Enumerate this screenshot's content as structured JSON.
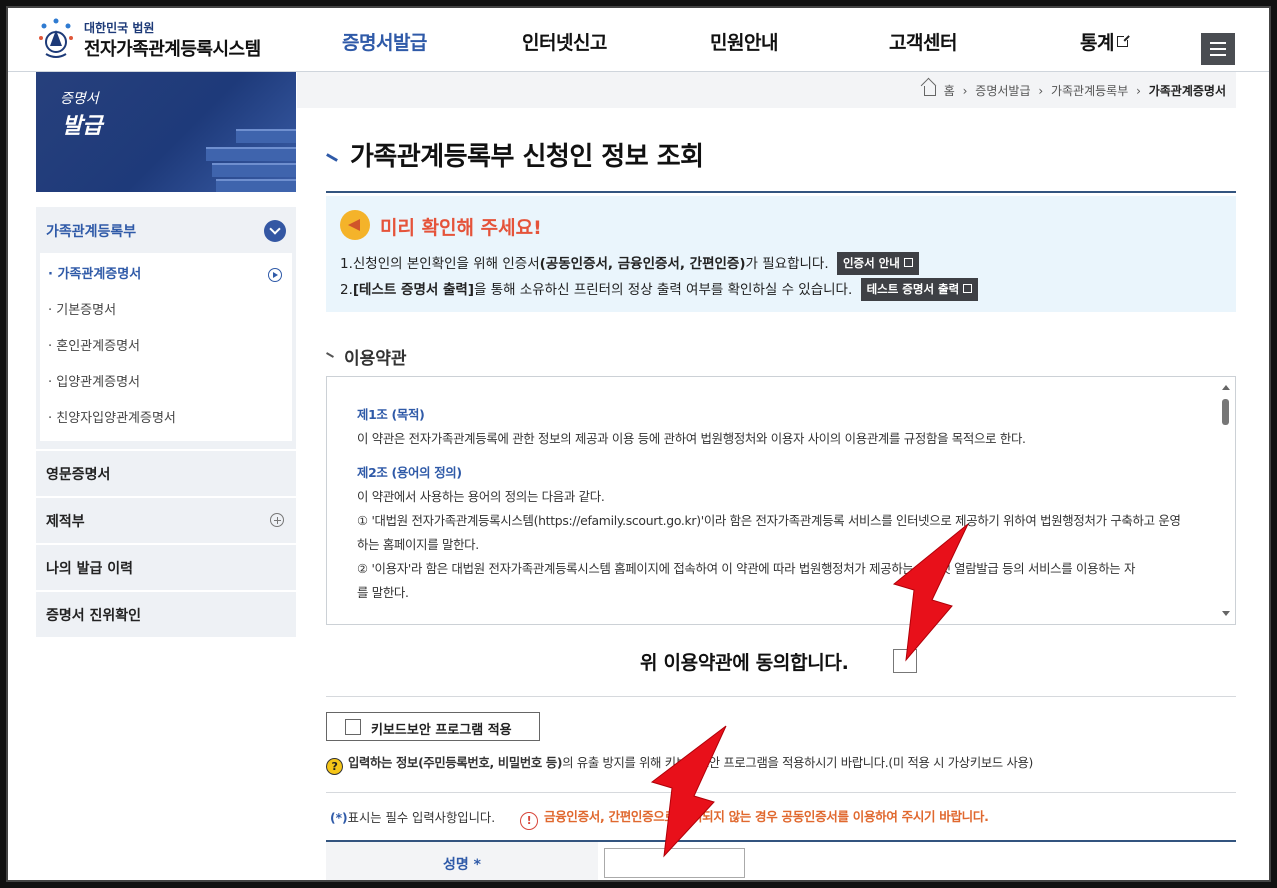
{
  "header": {
    "logo_sub": "대한민국 법원",
    "logo_main": "전자가족관계등록시스템",
    "nav": [
      {
        "label": "증명서발급"
      },
      {
        "label": "인터넷신고"
      },
      {
        "label": "민원안내"
      },
      {
        "label": "고객센터"
      },
      {
        "label": "통계"
      }
    ],
    "active_color": "#2f5aa8"
  },
  "banner": {
    "line1": "증명서",
    "line2": "발급"
  },
  "sidebar": {
    "group_title": "가족관계등록부",
    "sub_items": [
      {
        "label": "가족관계증명서"
      },
      {
        "label": "기본증명서"
      },
      {
        "label": "혼인관계증명서"
      },
      {
        "label": "입양관계증명서"
      },
      {
        "label": "친양자입양관계증명서"
      }
    ],
    "items": [
      {
        "label": "영문증명서"
      },
      {
        "label": "제적부"
      },
      {
        "label": "나의 발급 이력"
      },
      {
        "label": "증명서 진위확인"
      }
    ]
  },
  "breadcrumb": [
    "홈",
    "증명서발급",
    "가족관계등록부",
    "가족관계증명서"
  ],
  "page_title": "가족관계등록부 신청인 정보 조회",
  "notice": {
    "title": "미리 확인해 주세요!",
    "line1_a": "1.신청인의 본인확인을 위해 인증서",
    "line1_b": "(공동인증서, 금융인증서, 간편인증)",
    "line1_c": "가 필요합니다.",
    "cert_guide_button": "인증서 안내",
    "line2_a": "2.",
    "line2_b": "[테스트 증명서 출력]",
    "line2_c": "을 통해 소유하신 프린터의 정상 출력 여부를 확인하실 수 있습니다.",
    "test_print_button": "테스트 증명서 출력"
  },
  "terms": {
    "section_title": "이용약관",
    "article1_title": "제1조 (목적)",
    "article1_text": "이 약관은 전자가족관계등록에 관한 정보의 제공과 이용 등에 관하여 법원행정처와 이용자 사이의 이용관계를 규정함을 목적으로 한다.",
    "article2_title": "제2조 (용어의 정의)",
    "article2_text": "이 약관에서 사용하는 용어의 정의는 다음과 같다.",
    "item1": "① '대법원 전자가족관계등록시스템(https://efamily.scourt.go.kr)'이라 함은 전자가족관계등록 서비스를 인터넷으로 제공하기 위하여 법원행정처가 구축하고 운영",
    "item1_cont": "하는 홈페이지를 말한다.",
    "item2": "② '이용자'라 함은 대법원 전자가족관계등록시스템 홈페이지에 접속하여 이 약관에 따라 법원행정처가 제공하는 인터넷 열람발급 등의 서비스를 이용하는 자",
    "item2_cont": "를 말한다."
  },
  "agree_label": "위 이용약관에 동의합니다.",
  "keyboard_security_label": "키보드보안 프로그램 적용",
  "help_text_a": "입력하는 정보",
  "help_text_b": "(주민등록번호, 비밀번호 등)",
  "help_text_c": "의 유출 방지를 위해 키보드보안 프로그램을 적용하시기 바랍니다.(미 적용 시 가상키보드 사용)",
  "required_note": "표시는 필수 입력사항입니다.",
  "required_mark": "(*)",
  "warning_text": "금융인증서, 간편인증으로 처리되지 않는 경우 공동인증서를 이용하여 주시기 바랍니다.",
  "form": {
    "name_label": "성명",
    "name_value": ""
  }
}
